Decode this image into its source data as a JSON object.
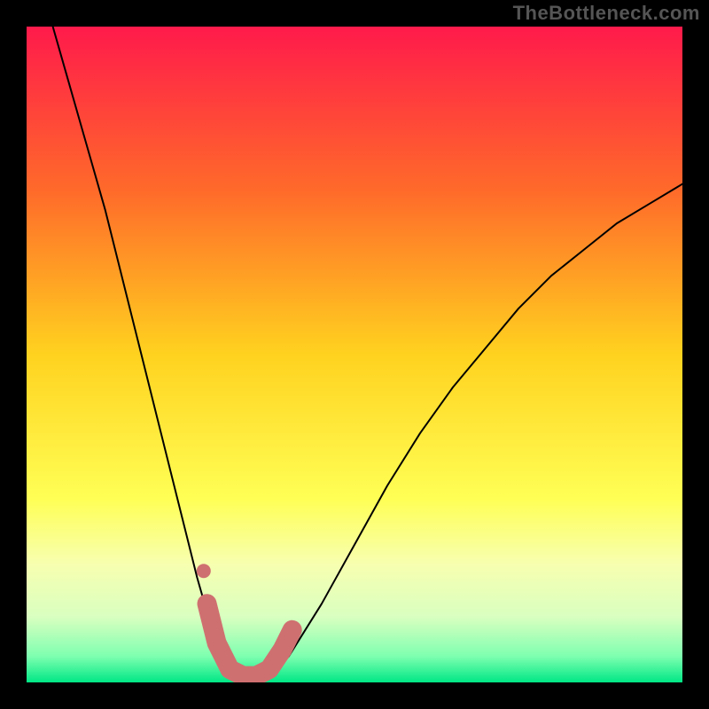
{
  "watermark": "TheBottleneck.com",
  "chart_data": {
    "type": "line",
    "title": "",
    "xlabel": "",
    "ylabel": "",
    "xlim": [
      0,
      100
    ],
    "ylim": [
      0,
      100
    ],
    "background_gradient": {
      "stops": [
        {
          "offset": 0.0,
          "color": "#ff1a4b"
        },
        {
          "offset": 0.25,
          "color": "#ff6a2a"
        },
        {
          "offset": 0.5,
          "color": "#ffd21f"
        },
        {
          "offset": 0.72,
          "color": "#ffff55"
        },
        {
          "offset": 0.82,
          "color": "#f7ffb0"
        },
        {
          "offset": 0.9,
          "color": "#d9ffc0"
        },
        {
          "offset": 0.96,
          "color": "#7fffb0"
        },
        {
          "offset": 1.0,
          "color": "#00e785"
        }
      ]
    },
    "series": [
      {
        "name": "bottleneck-curve",
        "x": [
          4,
          6,
          8,
          10,
          12,
          14,
          16,
          18,
          20,
          22,
          24,
          26,
          28,
          29.5,
          31,
          33,
          35,
          37,
          40,
          45,
          50,
          55,
          60,
          65,
          70,
          75,
          80,
          85,
          90,
          95,
          100
        ],
        "y": [
          100,
          93,
          86,
          79,
          72,
          64,
          56,
          48,
          40,
          32,
          24,
          16,
          9,
          4,
          1,
          0,
          0,
          1,
          4,
          12,
          21,
          30,
          38,
          45,
          51,
          57,
          62,
          66,
          70,
          73,
          76
        ]
      }
    ],
    "markers": {
      "name": "highlight-segment",
      "color": "#cf7070",
      "points": [
        {
          "x": 27.5,
          "y": 12
        },
        {
          "x": 29,
          "y": 6
        },
        {
          "x": 31,
          "y": 2
        },
        {
          "x": 33,
          "y": 1
        },
        {
          "x": 35,
          "y": 1
        },
        {
          "x": 37,
          "y": 2
        },
        {
          "x": 39,
          "y": 5
        },
        {
          "x": 40.5,
          "y": 8
        }
      ],
      "extra_dot": {
        "x": 27,
        "y": 17
      }
    }
  }
}
